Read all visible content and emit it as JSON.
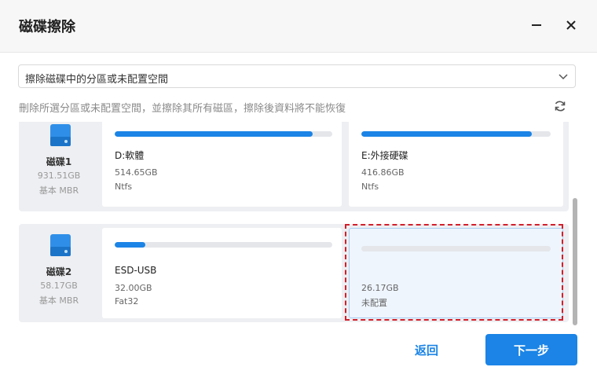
{
  "window": {
    "title": "磁碟擦除"
  },
  "dropdown": {
    "value": "擦除磁碟中的分區或未配置空間"
  },
  "description": "刪除所選分區或未配置空間，並擦除其所有磁區，擦除後資料將不能恢復",
  "disks": [
    {
      "name": "磁碟1",
      "size": "931.51GB",
      "type": "基本 MBR",
      "partitions": [
        {
          "label": "D:軟體",
          "size": "514.65GB",
          "fs": "Ntfs",
          "used": 0.91
        },
        {
          "label": "E:外接硬碟",
          "size": "416.86GB",
          "fs": "Ntfs",
          "used": 0.9
        }
      ]
    },
    {
      "name": "磁碟2",
      "size": "58.17GB",
      "type": "基本 MBR",
      "partitions": [
        {
          "label": "ESD-USB",
          "size": "32.00GB",
          "fs": "Fat32",
          "used": 0.14
        },
        {
          "label": "",
          "size": "26.17GB",
          "fs": "未配置",
          "used": 0
        }
      ]
    }
  ],
  "footer": {
    "back_label": "返回",
    "next_label": "下一步"
  },
  "colors": {
    "accent": "#1b84e6",
    "selection": "#d21f2b"
  }
}
